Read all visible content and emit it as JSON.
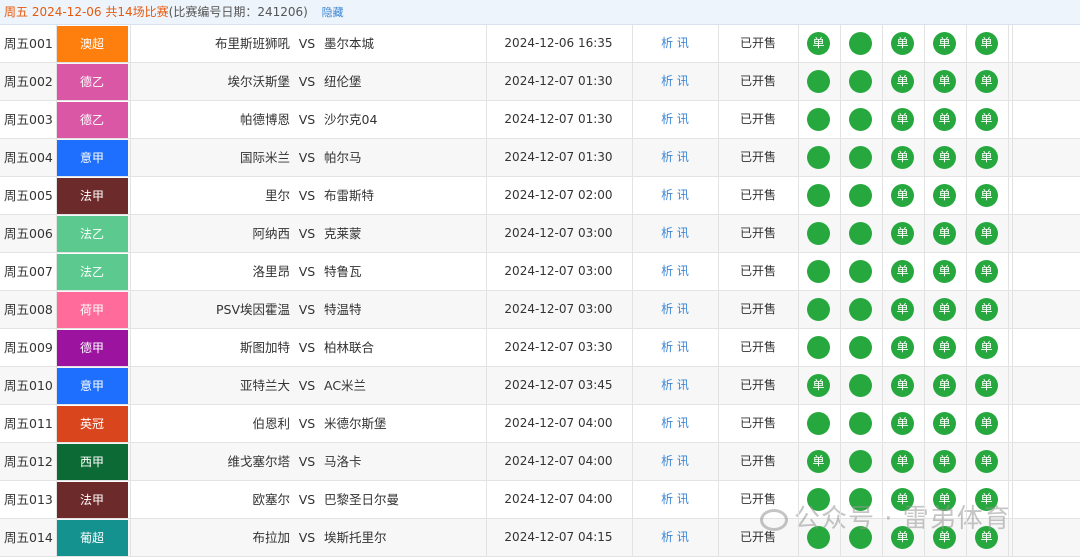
{
  "header": {
    "title": "周五 2024-12-06 共14场比赛",
    "note": "(比赛编号日期：241206)",
    "hide_label": "隐藏"
  },
  "vs_label": "VS",
  "info_label": "析 讯",
  "dot_label": "单",
  "watermark": "公众号 · 雷弟体育",
  "matches": [
    {
      "no": "周五001",
      "league": "澳超",
      "league_color": "#ff7f0e",
      "home": "布里斯班狮吼",
      "away": "墨尔本城",
      "time": "2024-12-06 16:35",
      "status": "已开售",
      "bets": [
        true,
        false,
        true,
        true,
        true
      ]
    },
    {
      "no": "周五002",
      "league": "德乙",
      "league_color": "#d957a4",
      "home": "埃尔沃斯堡",
      "away": "纽伦堡",
      "time": "2024-12-07 01:30",
      "status": "已开售",
      "bets": [
        false,
        false,
        true,
        true,
        true
      ]
    },
    {
      "no": "周五003",
      "league": "德乙",
      "league_color": "#d957a4",
      "home": "帕德博恩",
      "away": "沙尔克04",
      "time": "2024-12-07 01:30",
      "status": "已开售",
      "bets": [
        false,
        false,
        true,
        true,
        true
      ]
    },
    {
      "no": "周五004",
      "league": "意甲",
      "league_color": "#1f6fff",
      "home": "国际米兰",
      "away": "帕尔马",
      "time": "2024-12-07 01:30",
      "status": "已开售",
      "bets": [
        false,
        false,
        true,
        true,
        true
      ]
    },
    {
      "no": "周五005",
      "league": "法甲",
      "league_color": "#6d2a2a",
      "home": "里尔",
      "away": "布雷斯特",
      "time": "2024-12-07 02:00",
      "status": "已开售",
      "bets": [
        false,
        false,
        true,
        true,
        true
      ]
    },
    {
      "no": "周五006",
      "league": "法乙",
      "league_color": "#5cc98f",
      "home": "阿纳西",
      "away": "克莱蒙",
      "time": "2024-12-07 03:00",
      "status": "已开售",
      "bets": [
        false,
        false,
        true,
        true,
        true
      ]
    },
    {
      "no": "周五007",
      "league": "法乙",
      "league_color": "#5cc98f",
      "home": "洛里昂",
      "away": "特鲁瓦",
      "time": "2024-12-07 03:00",
      "status": "已开售",
      "bets": [
        false,
        false,
        true,
        true,
        true
      ]
    },
    {
      "no": "周五008",
      "league": "荷甲",
      "league_color": "#ff6b9a",
      "home": "PSV埃因霍温",
      "away": "特温特",
      "time": "2024-12-07 03:00",
      "status": "已开售",
      "bets": [
        false,
        false,
        true,
        true,
        true
      ]
    },
    {
      "no": "周五009",
      "league": "德甲",
      "league_color": "#9b139f",
      "home": "斯图加特",
      "away": "柏林联合",
      "time": "2024-12-07 03:30",
      "status": "已开售",
      "bets": [
        false,
        false,
        true,
        true,
        true
      ]
    },
    {
      "no": "周五010",
      "league": "意甲",
      "league_color": "#1f6fff",
      "home": "亚特兰大",
      "away": "AC米兰",
      "time": "2024-12-07 03:45",
      "status": "已开售",
      "bets": [
        true,
        false,
        true,
        true,
        true
      ]
    },
    {
      "no": "周五011",
      "league": "英冠",
      "league_color": "#d9461e",
      "home": "伯恩利",
      "away": "米德尔斯堡",
      "time": "2024-12-07 04:00",
      "status": "已开售",
      "bets": [
        false,
        false,
        true,
        true,
        true
      ]
    },
    {
      "no": "周五012",
      "league": "西甲",
      "league_color": "#0c6b34",
      "home": "维戈塞尔塔",
      "away": "马洛卡",
      "time": "2024-12-07 04:00",
      "status": "已开售",
      "bets": [
        true,
        false,
        true,
        true,
        true
      ]
    },
    {
      "no": "周五013",
      "league": "法甲",
      "league_color": "#6d2a2a",
      "home": "欧塞尔",
      "away": "巴黎圣日尔曼",
      "time": "2024-12-07 04:00",
      "status": "已开售",
      "bets": [
        false,
        false,
        true,
        true,
        true
      ]
    },
    {
      "no": "周五014",
      "league": "葡超",
      "league_color": "#13928f",
      "home": "布拉加",
      "away": "埃斯托里尔",
      "time": "2024-12-07 04:15",
      "status": "已开售",
      "bets": [
        false,
        false,
        true,
        true,
        true
      ]
    }
  ]
}
